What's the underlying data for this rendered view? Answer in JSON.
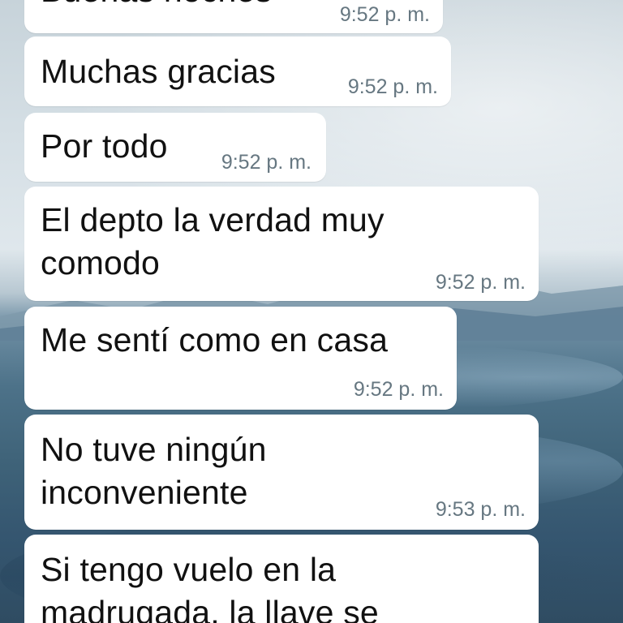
{
  "chat": {
    "messages": [
      {
        "text_lines": [
          "Buenas noches"
        ],
        "time": "9:52 p. m."
      },
      {
        "text_lines": [
          "Muchas gracias"
        ],
        "time": "9:52 p. m."
      },
      {
        "text_lines": [
          "Por todo"
        ],
        "time": "9:52 p. m."
      },
      {
        "text_lines": [
          "El depto la verdad muy",
          "comodo"
        ],
        "time": "9:52 p. m."
      },
      {
        "text_lines": [
          "Me sentí como en casa"
        ],
        "time": "9:52 p. m."
      },
      {
        "text_lines": [
          "No tuve ningún",
          "inconveniente"
        ],
        "time": "9:53 p. m."
      },
      {
        "text_lines": [
          "Si tengo vuelo en la",
          "madrugada, la llave se"
        ],
        "time": ""
      }
    ]
  },
  "colors": {
    "bubble_background": "#ffffff",
    "message_text": "#111111",
    "timestamp_text": "#667781"
  }
}
